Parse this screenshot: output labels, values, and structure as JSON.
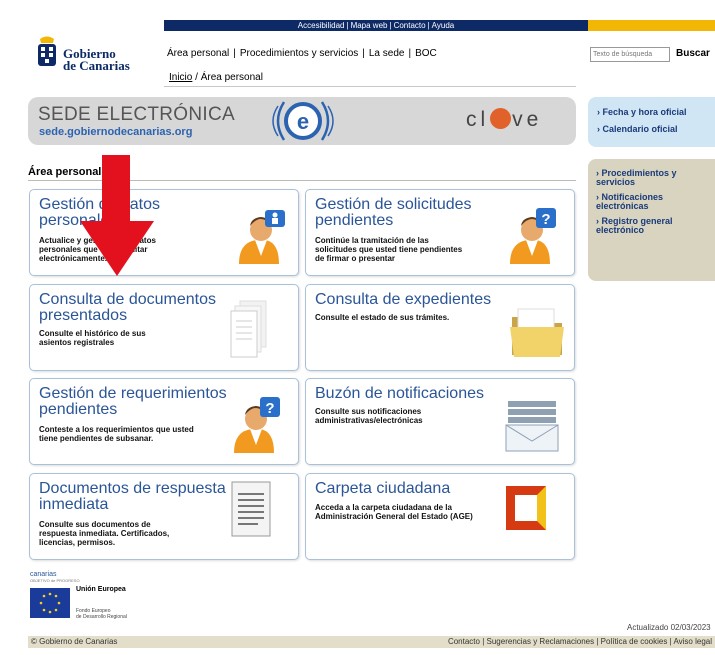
{
  "topbar": {
    "links": [
      "Accesibilidad",
      "Mapa web",
      "Contacto",
      "Ayuda"
    ]
  },
  "logo": {
    "line1": "Gobierno",
    "line2": "de Canarias"
  },
  "mainnav": {
    "items": [
      "Área personal",
      "Procedimientos y servicios",
      "La sede",
      "BOC"
    ]
  },
  "breadcrumb": {
    "home": "Inicio",
    "current": "Área personal",
    "sep": " / "
  },
  "search": {
    "placeholder": "Texto de búsqueda",
    "button": "Buscar"
  },
  "banner": {
    "title": "SEDE ELECTRÓNICA",
    "url": "sede.gobiernodecanarias.org",
    "e_letter": "e",
    "clave_left": "cl",
    "clave_right": "ve"
  },
  "side_top": [
    "Fecha y hora oficial",
    "Calendario oficial"
  ],
  "side_bottom": [
    "Procedimientos y servicios",
    "Notificaciones electrónicas",
    "Registro general electrónico"
  ],
  "area_title": "Área personal",
  "cards": [
    {
      "title": "Gestión de datos personales",
      "desc": "Actualice y gestione sus datos personales que va a tramitar electrónicamente.",
      "icon": "user-info-icon"
    },
    {
      "title": "Gestión de solicitudes pendientes",
      "desc": "Continúe la tramitación de las solicitudes que usted tiene pendientes de firmar o presentar",
      "icon": "user-question-icon"
    },
    {
      "title": "Consulta de documentos presentados",
      "desc": "Consulte el histórico de sus asientos registrales",
      "icon": "documents-icon"
    },
    {
      "title": "Consulta de expedientes",
      "desc": "Consulte el estado de sus trámites.",
      "icon": "folder-icon"
    },
    {
      "title": "Gestión de requerimientos pendientes",
      "desc": "Conteste a los requerimientos que usted tiene pendientes de subsanar.",
      "icon": "user-question-icon"
    },
    {
      "title": "Buzón de notificaciones",
      "desc": "Consulte sus notificaciones administrativas/electrónicas",
      "icon": "mailbox-icon"
    },
    {
      "title": "Documentos de respuesta inmediata",
      "desc": "Consulte sus documentos de respuesta inmediata. Certificados, licencias, permisos.",
      "icon": "document-lines-icon"
    },
    {
      "title": "Carpeta ciudadana",
      "desc": "Acceda a la carpeta ciudadana de la Administración General del Estado (AGE)",
      "icon": "carpeta-ciudadana-icon"
    }
  ],
  "eu": {
    "canarias": "canarias",
    "canarias_sub": "OBJETIVO de PROGRESO",
    "union": "Unión Europea",
    "fondo1": "Fondo Europeo",
    "fondo2": "de Desarrollo Regional"
  },
  "updated": "Actualizado 02/03/2023",
  "footer": {
    "left": "© Gobierno de Canarias",
    "links": [
      "Contacto",
      "Sugerencias y Reclamaciones",
      "Política de cookies",
      "Aviso legal"
    ]
  },
  "colors": {
    "navy": "#0d2a66",
    "link_blue": "#2a5597",
    "accent_yellow": "#f2b705",
    "arrow_red": "#e3111d"
  }
}
